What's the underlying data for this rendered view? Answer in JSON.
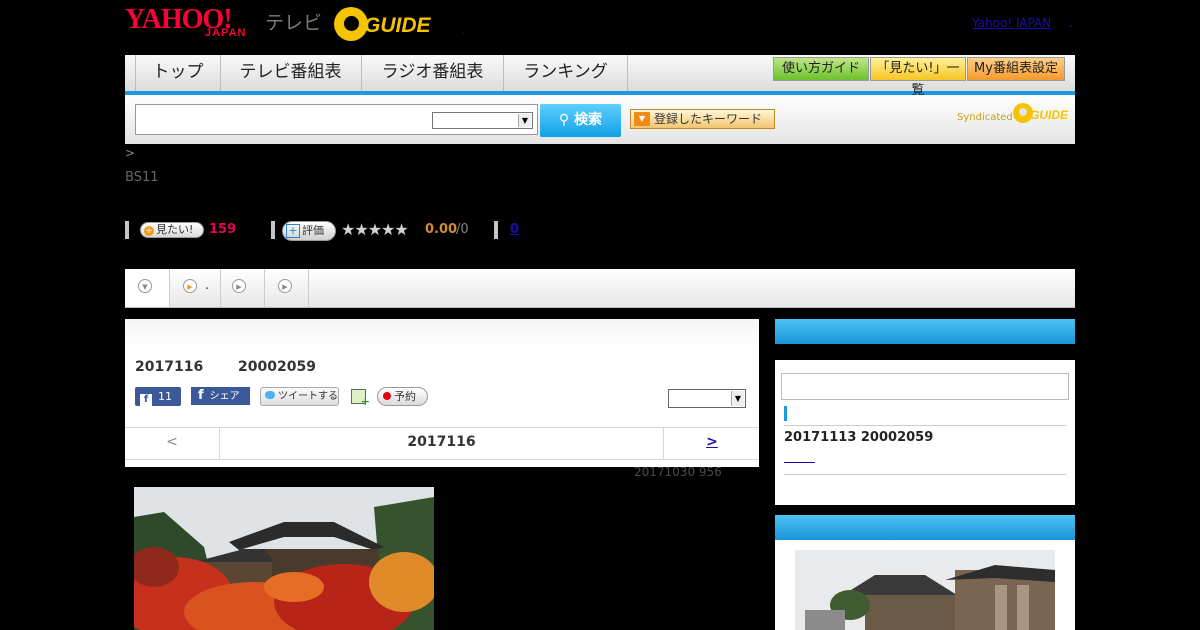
{
  "header": {
    "logo_yahoo": "YAHOO!",
    "logo_japan": "JAPAN",
    "logo_tv": "テレビ",
    "logo_gguide": "GUIDE",
    "yahoo_japan_link": "Yahoo! JAPAN",
    "dot": ".",
    "small_dot": "."
  },
  "nav": {
    "tabs": [
      "トップ",
      "テレビ番組表",
      "ラジオ番組表",
      "ランキング"
    ],
    "guide_buttons": [
      "使い方ガイド",
      "「見たい!」一覧",
      "My番組表設定"
    ]
  },
  "search": {
    "query": "",
    "select_value": "",
    "button_label": "検索",
    "keyword_button": "登録したキーワード",
    "syndicated_label": "Syndicated",
    "syndicated_logo": "GUIDE"
  },
  "breadcrumb": ">",
  "channel": "BS11",
  "actions": {
    "want_label": "見たい!",
    "want_count": "159",
    "rate_label": "評価",
    "stars": "★★★★★",
    "rating": "0.00",
    "rating_count": "/0",
    "link_count": "0"
  },
  "tabs": {
    "tab2_label": "."
  },
  "program": {
    "date": "2017116",
    "time": "20002059",
    "fb_like_count": "11",
    "fb_share_label": "シェア",
    "tweet_label": "ツイートする",
    "reserve_label": "予約",
    "select_value": "",
    "pager_prev": "<",
    "pager_current": "2017116",
    "pager_next": ">",
    "updated": "20171030  956"
  },
  "sidebar": {
    "program_line": "20171113  20002059"
  },
  "colors": {
    "accent_blue": "#1c9ae0",
    "yahoo_red": "#ff0033",
    "gguide_yellow": "#f5c400",
    "want_pink": "#e5005a",
    "rating_orange": "#d08a30"
  }
}
